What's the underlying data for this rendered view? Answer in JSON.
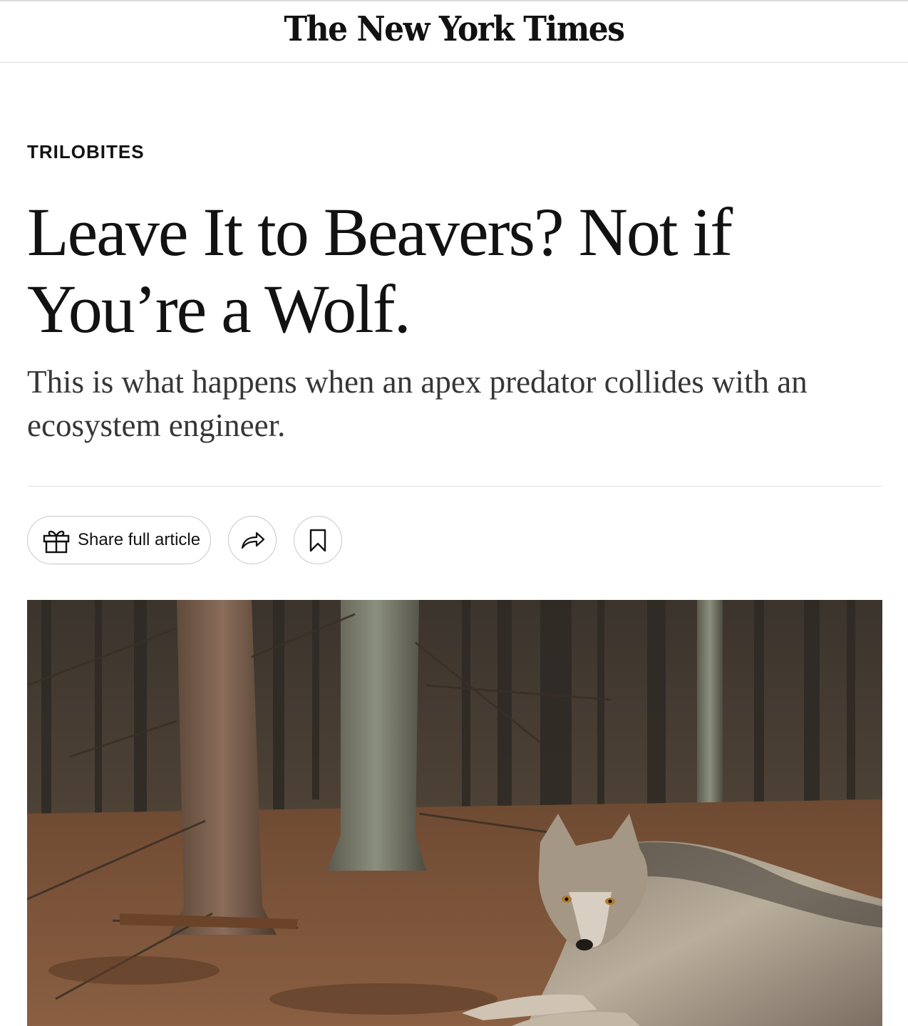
{
  "masthead": {
    "logo_text": "The New York Times"
  },
  "article": {
    "kicker": "TRILOBITES",
    "headline": "Leave It to Beavers? Not if You’re a Wolf.",
    "summary": "This is what happens when an apex predator collides with an ecosystem engineer."
  },
  "actions": {
    "share_full_article_label": "Share full article",
    "share_icon": "share-arrow-icon",
    "save_icon": "bookmark-icon",
    "gift_icon": "gift-icon"
  },
  "image": {
    "subject": "wolf-in-forest"
  }
}
